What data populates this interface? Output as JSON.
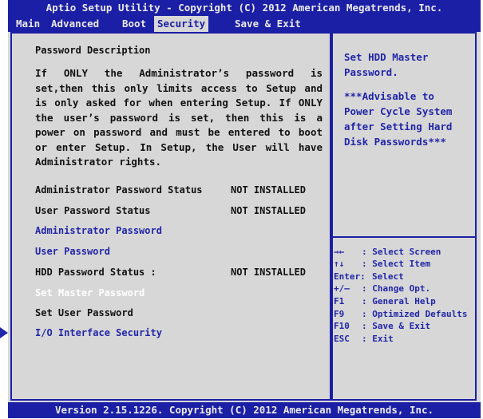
{
  "title_bar": "Aptio Setup Utility - Copyright (C) 2012 American Megatrends, Inc.",
  "tabs": [
    "Main",
    "Advanced",
    "Boot",
    "Security",
    "Save & Exit"
  ],
  "active_tab": "Security",
  "main": {
    "heading": "Password Description",
    "description": "If ONLY the Administrator’s password is set,then this only limits access to Setup and is only asked for when entering Setup. If ONLY the user’s password is set, then this is a power on password and must be entered to boot or enter Setup. In Setup, the User will have Administrator rights.",
    "admin_status_label": "Administrator Password Status",
    "admin_status_value": "NOT INSTALLED",
    "user_status_label": "User Password Status",
    "user_status_value": "NOT INSTALLED",
    "admin_password": "Administrator Password",
    "user_password": "User Password",
    "hdd_status_label": "HDD Password Status :",
    "hdd_status_value": "NOT INSTALLED",
    "set_master_password": "Set Master Password",
    "set_user_password": "Set User Password",
    "io_interface_security": "I/O Interface Security"
  },
  "help": {
    "line1": "Set HDD Master",
    "line2": "Password.",
    "note1": "***Advisable to",
    "note2": "Power Cycle System",
    "note3": "after Setting Hard",
    "note4": "Disk Passwords***"
  },
  "keys": [
    {
      "key": "→←",
      "desc": ": Select Screen"
    },
    {
      "key": "↑↓",
      "desc": ": Select Item"
    },
    {
      "key": "Enter:",
      "desc": "Select"
    },
    {
      "key": "+/—",
      "desc": ": Change Opt."
    },
    {
      "key": "F1",
      "desc": ": General Help"
    },
    {
      "key": "F9",
      "desc": ": Optimized Defaults"
    },
    {
      "key": "F10",
      "desc": ": Save & Exit"
    },
    {
      "key": "ESC",
      "desc": ": Exit"
    }
  ],
  "footer": "Version 2.15.1226. Copyright (C) 2012 American Megatrends, Inc.",
  "colors": {
    "frame_blue": "#1b1fa5",
    "panel_gray": "#d7d7d7",
    "link_blue": "#2226a8",
    "highlight": "#ffffff"
  }
}
